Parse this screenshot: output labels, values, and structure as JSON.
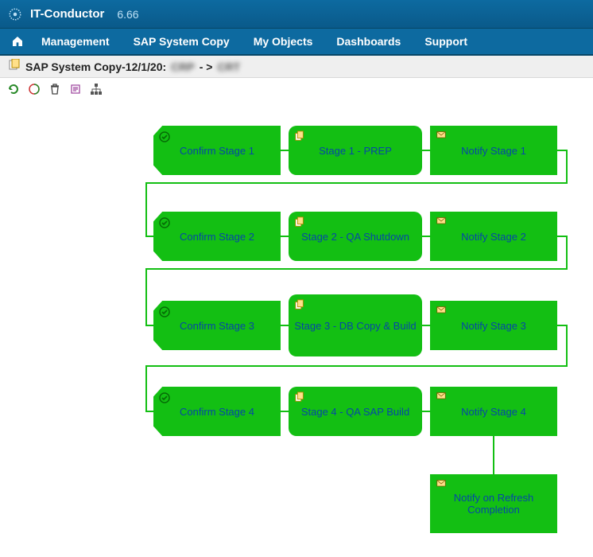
{
  "app": {
    "name": "IT-Conductor",
    "version": "6.66"
  },
  "menu": {
    "home": "Home",
    "items": [
      "Management",
      "SAP System Copy",
      "My Objects",
      "Dashboards",
      "Support"
    ]
  },
  "breadcrumb": {
    "label": "SAP System Copy-12/1/20:",
    "src": "CRP",
    "sep": "- >",
    "dst": "CRT"
  },
  "toolbar": {
    "refresh": "Refresh",
    "run": "Run",
    "delete": "Delete",
    "log": "Log",
    "tree": "Hierarchy"
  },
  "nodes": {
    "confirm1": "Confirm Stage 1",
    "stage1": "Stage 1 - PREP",
    "notify1": "Notify Stage 1",
    "confirm2": "Confirm Stage 2",
    "stage2": "Stage 2 - QA Shutdown",
    "notify2": "Notify Stage 2",
    "confirm3": "Confirm Stage 3",
    "stage3": "Stage 3 - DB Copy & Build",
    "notify3": "Notify Stage 3",
    "confirm4": "Confirm Stage 4",
    "stage4": "Stage 4 - QA SAP Build",
    "notify4": "Notify Stage 4",
    "notify5": "Notify on Refresh Completion"
  },
  "colors": {
    "node": "#13bf13",
    "link": "#0647a7",
    "edge": "#13bf13"
  }
}
